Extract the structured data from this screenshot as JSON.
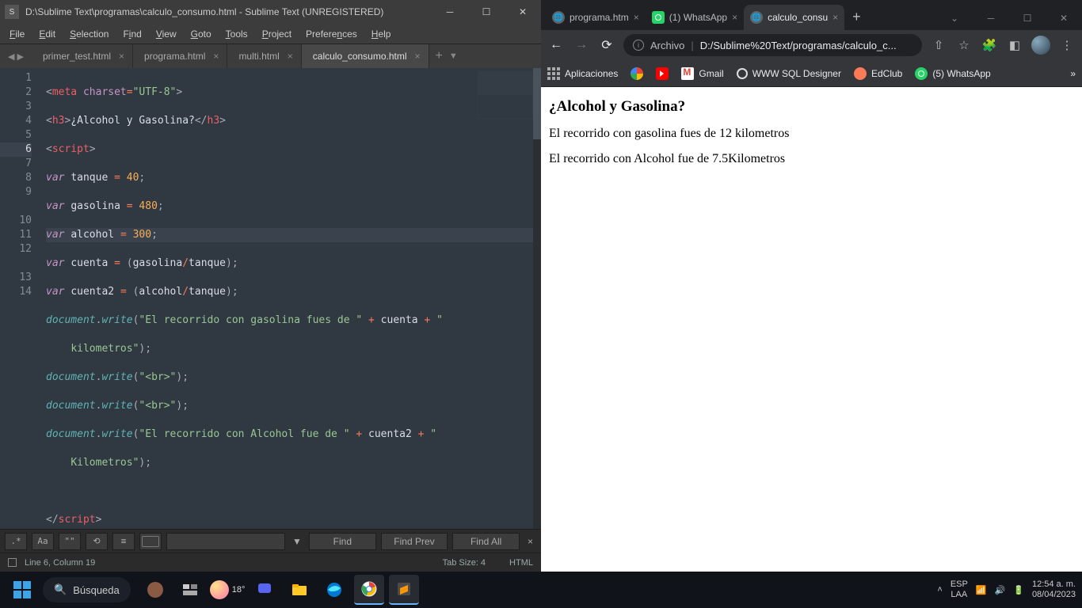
{
  "sublime": {
    "title": "D:\\Sublime Text\\programas\\calculo_consumo.html - Sublime Text (UNREGISTERED)",
    "menu": [
      "File",
      "Edit",
      "Selection",
      "Find",
      "View",
      "Goto",
      "Tools",
      "Project",
      "Preferences",
      "Help"
    ],
    "tabs": [
      {
        "label": "primer_test.html"
      },
      {
        "label": "programa.html"
      },
      {
        "label": "multi.html"
      },
      {
        "label": "calculo_consumo.html"
      }
    ],
    "code": {
      "lines": [
        "1",
        "2",
        "3",
        "4",
        "5",
        "6",
        "7",
        "8",
        "9",
        "10",
        "11",
        "12",
        "13",
        "14"
      ],
      "l1a": "meta",
      "l1b": "charset",
      "l1c": "\"UTF-8\"",
      "l2a": "h3",
      "l2b": "¿Alcohol y Gasolina?",
      "l2c": "h3",
      "l3a": "script",
      "l4_kw": "var",
      "l4_n": "tanque",
      "l4_v": "40",
      "l5_kw": "var",
      "l5_n": "gasolina",
      "l5_v": "480",
      "l6_kw": "var",
      "l6_n": "alcohol",
      "l6_v": "300",
      "l7_kw": "var",
      "l7_n": "cuenta",
      "l7_a": "gasolina",
      "l7_b": "tanque",
      "l8_kw": "var",
      "l8_n": "cuenta2",
      "l8_a": "alcohol",
      "l8_b": "tanque",
      "l9_o": "document",
      "l9_f": "write",
      "l9_s1": "\"El recorrido con gasolina fues de \"",
      "l9_v": "cuenta",
      "l9_s2": "\" ",
      "l9b_s": "kilometros\"",
      "l10_o": "document",
      "l10_f": "write",
      "l10_s": "\"<br>\"",
      "l11_o": "document",
      "l11_f": "write",
      "l11_s": "\"<br>\"",
      "l12_o": "document",
      "l12_f": "write",
      "l12_s1": "\"El recorrido con Alcohol fue de \"",
      "l12_v": "cuenta2",
      "l12_s2": "\" ",
      "l12b_s": "Kilometros\"",
      "l14a": "script"
    },
    "find": {
      "regex": ".*",
      "case": "Aa",
      "whole": "\"\"",
      "btn1": "Find",
      "btn2": "Find Prev",
      "btn3": "Find All"
    },
    "status": {
      "pos": "Line 6, Column 19",
      "tab": "Tab Size: 4",
      "lang": "HTML"
    }
  },
  "chrome": {
    "tabs": [
      {
        "label": "programa.htm"
      },
      {
        "label": "(1) WhatsApp",
        "badge": "1"
      },
      {
        "label": "calculo_consu"
      }
    ],
    "addr": {
      "label": "Archivo",
      "url": "D:/Sublime%20Text/programas/calculo_c..."
    },
    "bookmarks": {
      "apps": "Aplicaciones",
      "gmail": "Gmail",
      "sql": "WWW SQL Designer",
      "ed": "EdClub",
      "wa": "(5) WhatsApp"
    },
    "page": {
      "title": "¿Alcohol y Gasolina?",
      "p1": "El recorrido con gasolina fues de 12 kilometros",
      "p2": "El recorrido con Alcohol fue de 7.5Kilometros"
    }
  },
  "taskbar": {
    "search": "Búsqueda",
    "temp": "18°",
    "lang1": "ESP",
    "lang2": "LAA",
    "time": "12:54 a. m.",
    "date": "08/04/2023"
  }
}
